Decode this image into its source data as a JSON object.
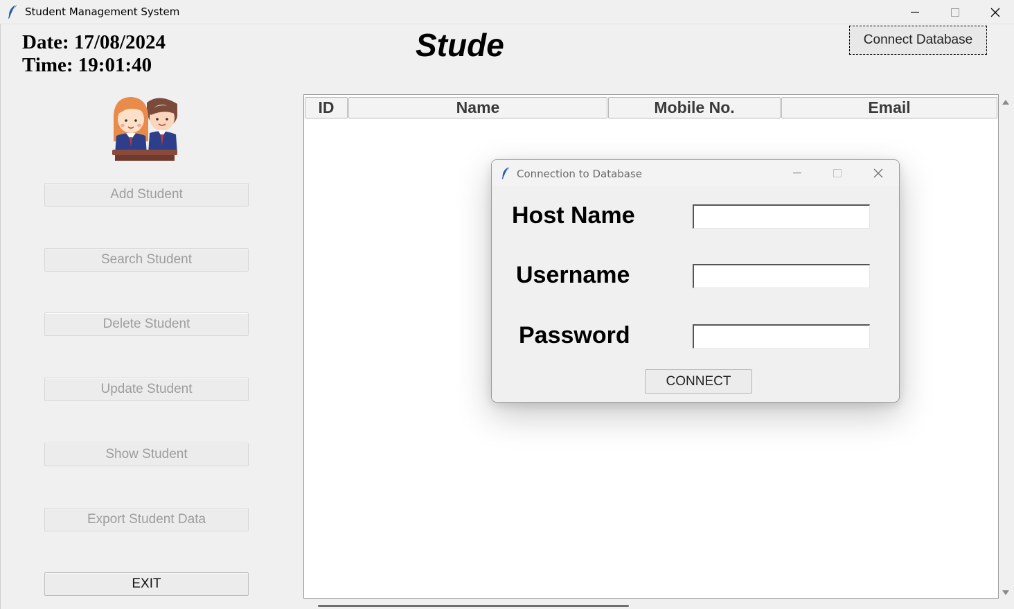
{
  "window": {
    "title": "Student Management System"
  },
  "header": {
    "date": "Date: 17/08/2024",
    "time": "Time: 19:01:40",
    "slider_text": "Stude",
    "connect_button": "Connect Database"
  },
  "sidebar": {
    "buttons": [
      {
        "label": "Add Student",
        "enabled": false
      },
      {
        "label": "Search Student",
        "enabled": false
      },
      {
        "label": "Delete Student",
        "enabled": false
      },
      {
        "label": "Update Student",
        "enabled": false
      },
      {
        "label": "Show Student",
        "enabled": false
      },
      {
        "label": "Export Student Data",
        "enabled": false
      },
      {
        "label": "EXIT",
        "enabled": true
      }
    ]
  },
  "table": {
    "columns": [
      "ID",
      "Name",
      "Mobile No.",
      "Email"
    ],
    "rows": []
  },
  "dialog": {
    "title": "Connection to Database",
    "fields": [
      {
        "label": "Host Name",
        "value": ""
      },
      {
        "label": "Username",
        "value": ""
      },
      {
        "label": "Password",
        "value": ""
      }
    ],
    "connect_button": "CONNECT"
  },
  "icons": {
    "app": "feather-icon",
    "avatar": "students-avatar-icon"
  }
}
